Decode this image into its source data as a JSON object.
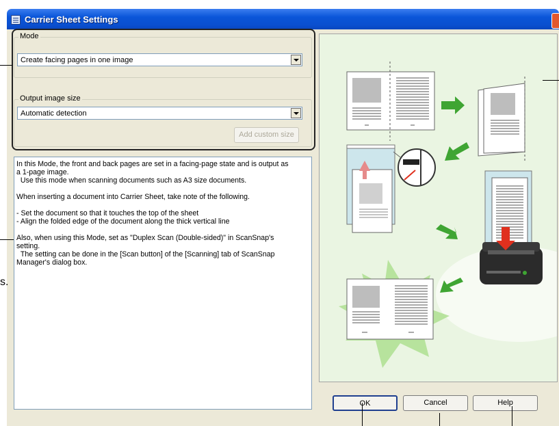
{
  "window": {
    "title": "Carrier Sheet Settings"
  },
  "mode": {
    "label": "Mode",
    "selected": "Create facing pages in one image"
  },
  "output_size": {
    "label": "Output image size",
    "selected": "Automatic detection",
    "add_custom_label": "Add custom size"
  },
  "description": {
    "text": "In this Mode, the front and back pages are set in a facing-page state and is output as\na 1-page image.\n  Use this mode when scanning documents such as A3 size documents.\n\nWhen inserting a document into Carrier Sheet, take note of the following.\n\n- Set the document so that it touches the top of the sheet\n- Align the folded edge of the document along the thick vertical line\n\nAlso, when using this Mode, set as \"Duplex Scan (Double-sided)\" in ScanSnap's\nsetting.\n  The setting can be done in the [Scan button] of the [Scanning] tab of ScanSnap\nManager's dialog box."
  },
  "buttons": {
    "ok": "OK",
    "cancel": "Cancel",
    "help": "Help"
  },
  "page_edge_text": "s.",
  "colors": {
    "title_bar": "#0a55d8",
    "dialog_face": "#ece9d8",
    "illustration_bg": "#eaf5e2",
    "arrow_green": "#3fa533",
    "arrow_red": "#e0301e"
  }
}
